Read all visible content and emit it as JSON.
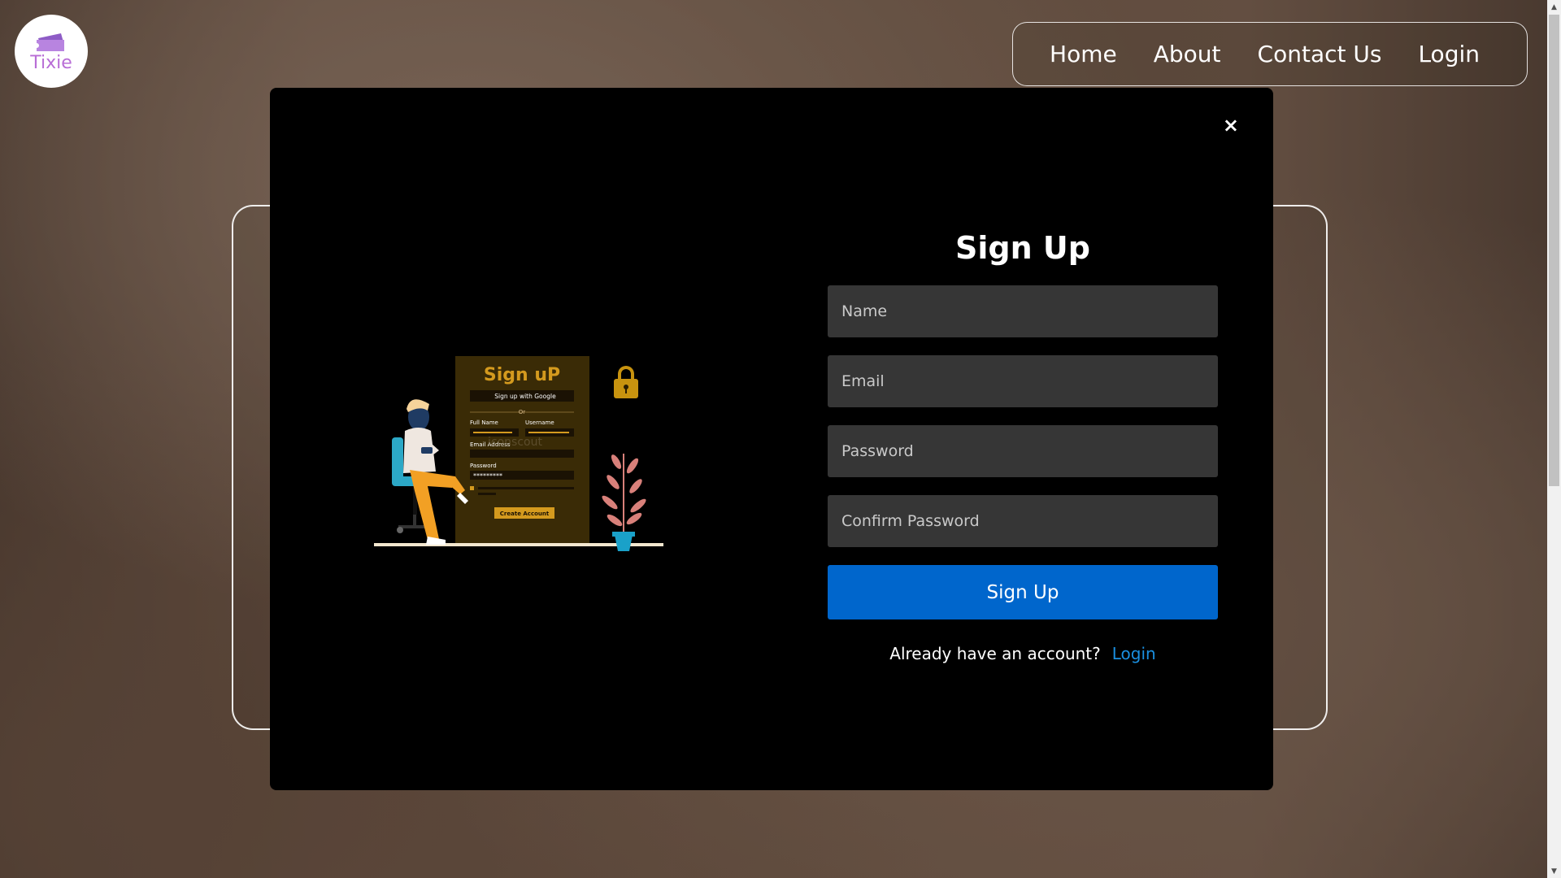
{
  "logo": {
    "text": "Tixie"
  },
  "nav": {
    "items": [
      {
        "label": "Home"
      },
      {
        "label": "About"
      },
      {
        "label": "Contact Us"
      },
      {
        "label": "Login"
      }
    ]
  },
  "modal": {
    "close_label": "×",
    "illustration": {
      "title": "Sign uP",
      "google_button": "Sign up with Google",
      "or_text": "Or",
      "full_name_label": "Full Name",
      "username_label": "Username",
      "email_label": "Email Address",
      "password_label": "Password",
      "password_mask": "*********",
      "create_button": "Create Account"
    },
    "form": {
      "title": "Sign Up",
      "name_placeholder": "Name",
      "email_placeholder": "Email",
      "password_placeholder": "Password",
      "confirm_placeholder": "Confirm Password",
      "submit_label": "Sign Up",
      "account_prompt": "Already have an account?",
      "login_link": "Login"
    }
  },
  "colors": {
    "accent": "#0066cc",
    "link": "#1a8fe0",
    "logo_purple": "#b86dd6",
    "modal_bg": "#000000",
    "field_bg": "#363636"
  }
}
